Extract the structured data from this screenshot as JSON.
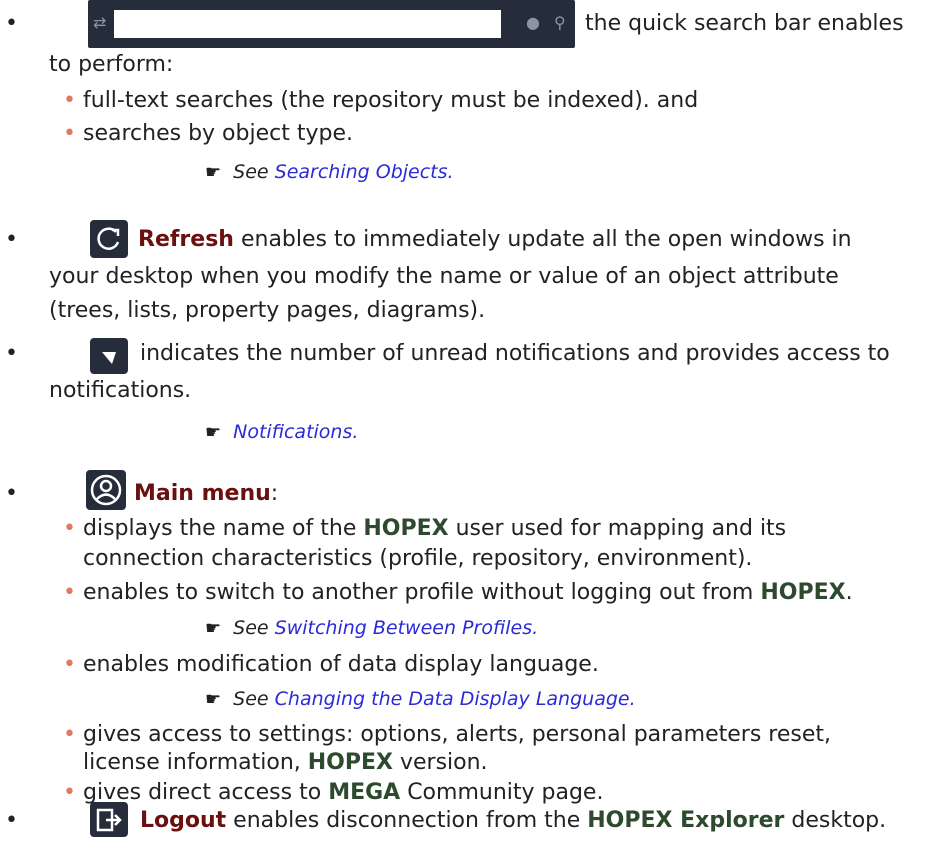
{
  "b1": {
    "text_after": "the quick search bar enables",
    "text_cont": "to perform:",
    "subs": [
      "full-text searches (the repository must be indexed). and",
      "searches by object type."
    ],
    "see_prefix": "See",
    "see_link": "Searching Objects."
  },
  "b2": {
    "bold": "Refresh",
    "text1": " enables to immediately update all the open windows in",
    "text2": "your desktop when you modify the name or value of an object attribute",
    "text3": "(trees, lists, property pages, diagrams)."
  },
  "b3": {
    "text1": "indicates the number of unread notifications and provides access to",
    "text2": "notifications.",
    "see_link": "Notifications."
  },
  "b4": {
    "bold": "Main menu",
    "colon": ":",
    "s1a": "displays the name of the ",
    "hopex": "HOPEX",
    "s1b": " user used for mapping and its",
    "s1c": "connection characteristics (profile, repository, environment).",
    "s2a": "enables to switch to another profile without logging out from ",
    "s2b": ".",
    "see1_prefix": "See",
    "see1_link": "Switching Between Profiles.",
    "s3": "enables modification of data display language.",
    "see2_prefix": "See",
    "see2_link": "Changing the Data Display Language.",
    "s4a": "gives access to settings: options, alerts, personal parameters reset,",
    "s4b": "license information, ",
    "s4c": " version.",
    "s5a": "gives direct access to ",
    "mega": "MEGA",
    "s5b": " Community page."
  },
  "b5": {
    "bold": "Logout",
    "text1": " enables disconnection from the ",
    "explorer": "HOPEX Explorer",
    "text2": " desktop."
  },
  "bullet_char": "•",
  "hand_char": "☛"
}
